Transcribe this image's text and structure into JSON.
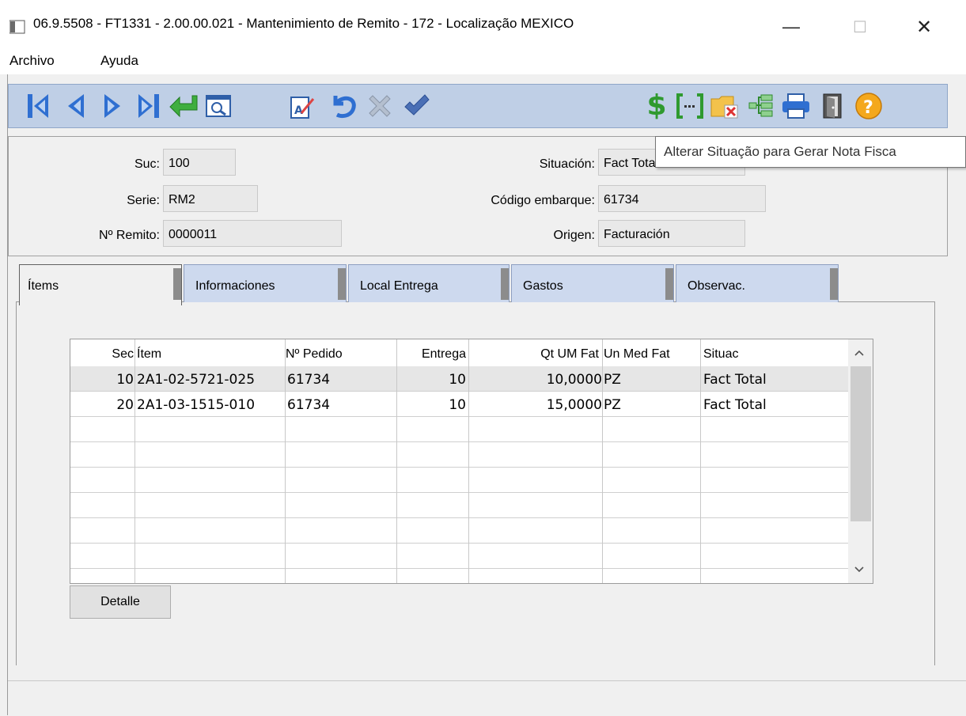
{
  "window": {
    "title": "06.9.5508 - FT1331 - 2.00.00.021 - Mantenimiento de Remito - 172 - Localização MEXICO",
    "minimize": "—",
    "maximize": "☐",
    "close": "✕"
  },
  "menu": {
    "items": [
      "Archivo",
      "Ayuda"
    ]
  },
  "toolbar": {
    "left_icons": [
      "first-record-icon",
      "previous-record-icon",
      "next-record-icon",
      "last-record-icon",
      "confirm-enter-icon",
      "view-icon",
      "edit-icon",
      "undo-icon",
      "delete-icon",
      "check-icon"
    ],
    "right_icons": [
      "dollar-icon",
      "bracket-icon",
      "folder-delete-icon",
      "tree-icon",
      "printer-icon",
      "exit-door-icon",
      "help-icon"
    ],
    "tooltip": "Alterar Situação para Gerar Nota Fisca"
  },
  "header": {
    "suc_label": "Suc:",
    "suc_value": "100",
    "serie_label": "Serie:",
    "serie_value": "RM2",
    "remito_label": "Nº Remito:",
    "remito_value": "0000011",
    "situacion_label": "Situación:",
    "situacion_value": "Fact Total",
    "codigo_label": "Código embarque:",
    "codigo_value": "61734",
    "origen_label": "Origen:",
    "origen_value": "Facturación"
  },
  "tabs": [
    "Ítems",
    "Informaciones",
    "Local Entrega",
    "Gastos",
    "Observac."
  ],
  "grid": {
    "columns": [
      "Sec",
      "Ítem",
      "Nº Pedido",
      "Entrega",
      "Qt UM Fat",
      "Un Med Fat",
      "Situac"
    ],
    "rows": [
      {
        "sec": "10",
        "item": "2A1-02-5721-025",
        "pedido": "61734",
        "entrega": "10",
        "qt": "10,0000",
        "um": "PZ",
        "situac": "Fact Total"
      },
      {
        "sec": "20",
        "item": "2A1-03-1515-010",
        "pedido": "61734",
        "entrega": "10",
        "qt": "15,0000",
        "um": "PZ",
        "situac": "Fact Total"
      }
    ]
  },
  "buttons": {
    "detalle": "Detalle"
  }
}
